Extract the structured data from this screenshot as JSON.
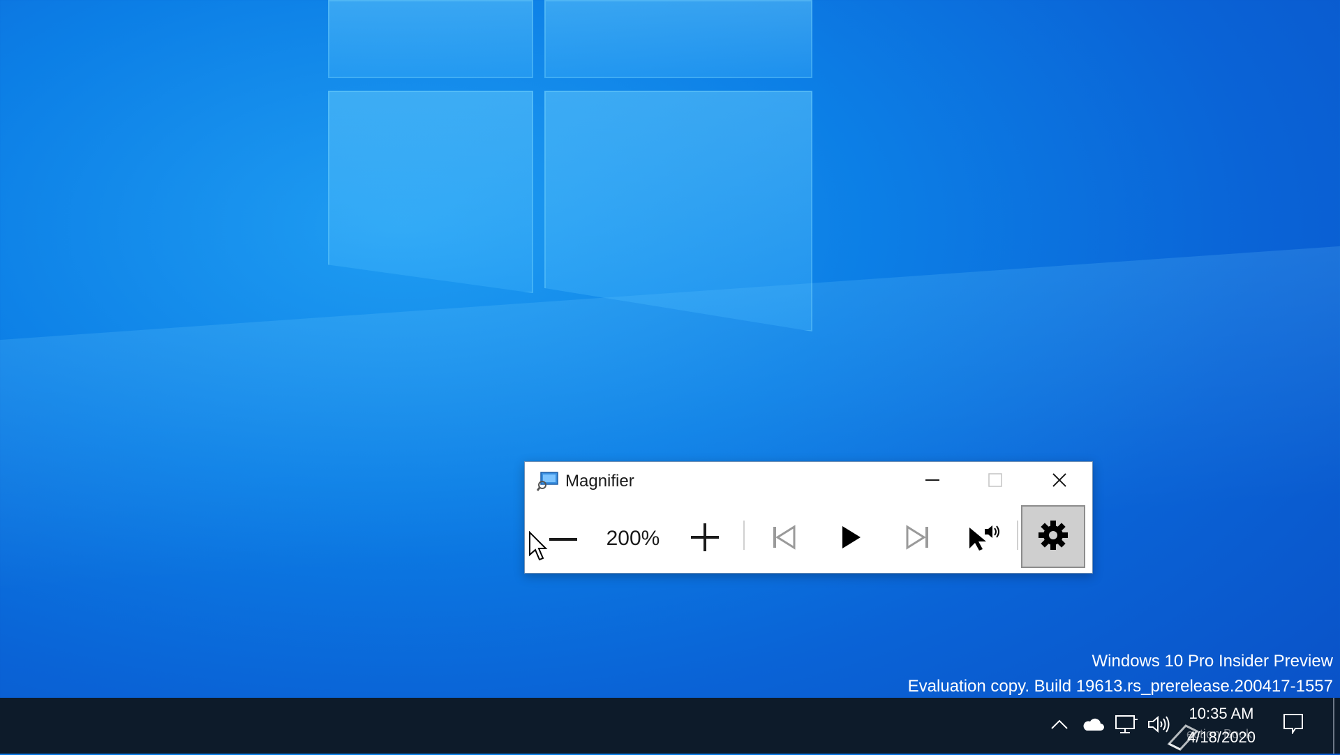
{
  "desktop": {
    "watermark_line1": "Windows 10 Pro Insider Preview",
    "watermark_line2": "Evaluation copy. Build 19613.rs_prerelease.200417-1557"
  },
  "magnifier": {
    "title": "Magnifier",
    "zoom_level": "200%",
    "icons": {
      "app": "magnifier-app-icon",
      "minimize": "minimize-icon",
      "maximize": "maximize-icon",
      "close": "close-icon",
      "zoom_out": "minus-icon",
      "zoom_in": "plus-icon",
      "previous": "skip-previous-icon",
      "play": "play-icon",
      "next": "skip-next-icon",
      "read_from_click": "pointer-speaker-icon",
      "settings": "gear-icon"
    },
    "colors": {
      "window_border": "#6f8fb4",
      "settings_pressed": "#cfcfcf",
      "disabled_icon": "#9a9a9a"
    }
  },
  "taskbar": {
    "time": "10:35 AM",
    "date": "4/18/2020",
    "faint_label": "ection Book",
    "tray_icons": [
      "chevron-up-icon",
      "onedrive-cloud-icon",
      "network-icon",
      "volume-icon",
      "action-center-icon"
    ],
    "colors": {
      "background": "#0d1b2a"
    }
  }
}
